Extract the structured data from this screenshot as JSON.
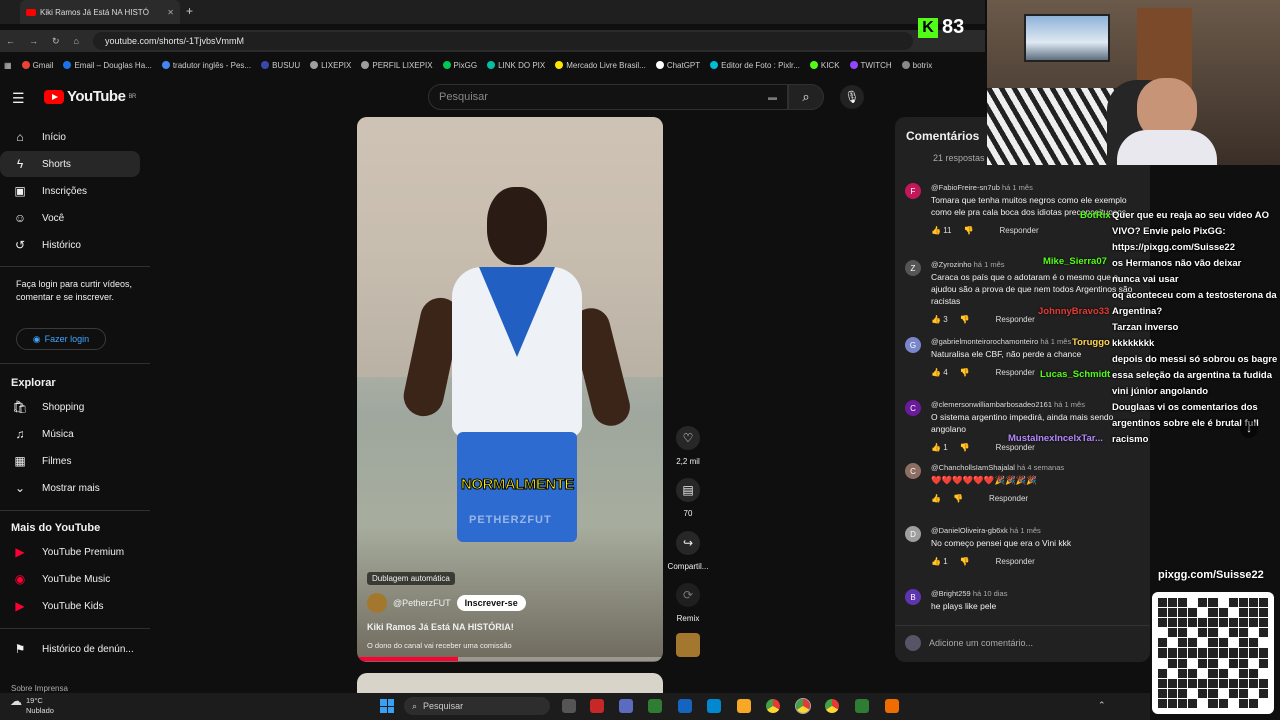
{
  "browser": {
    "tab_title": "Kiki Ramos Já Está NA HISTÓ",
    "url": "youtube.com/shorts/-1TjvbsVmmM",
    "bookmarks": [
      "Gmail",
      "Email – Douglas Ha...",
      "tradutor inglês - Pes...",
      "BUSUU",
      "LIXEPIX",
      "PERFIL LIXEPIX",
      "PixGG",
      "LINK DO PIX",
      "Mercado Livre Brasil...",
      "ChatGPT",
      "Editor de Foto : Pixlr...",
      "KICK",
      "TWITCH",
      "botrix"
    ]
  },
  "youtube": {
    "logo_text": "YouTube",
    "region": "BR",
    "search_placeholder": "Pesquisar",
    "sidebar": {
      "main": [
        {
          "label": "Início",
          "icon": "home-icon"
        },
        {
          "label": "Shorts",
          "icon": "shorts-icon"
        },
        {
          "label": "Inscrições",
          "icon": "subscriptions-icon"
        },
        {
          "label": "Você",
          "icon": "you-icon"
        },
        {
          "label": "Histórico",
          "icon": "history-icon"
        }
      ],
      "login_prompt": "Faça login para curtir vídeos, comentar e se inscrever.",
      "login_button": "Fazer login",
      "explore_title": "Explorar",
      "explore": [
        {
          "label": "Shopping"
        },
        {
          "label": "Música"
        },
        {
          "label": "Filmes"
        },
        {
          "label": "Mostrar mais"
        }
      ],
      "more_title": "Mais do YouTube",
      "more": [
        {
          "label": "YouTube Premium"
        },
        {
          "label": "YouTube Music"
        },
        {
          "label": "YouTube Kids"
        }
      ],
      "report_history": "Histórico de denún...",
      "footer": "Sobre  Imprensa"
    },
    "short": {
      "caption": "NORMALMENTE",
      "watermark": "PETHERZFUT",
      "dub_badge": "Dublagem automática",
      "channel": "@PetherzFUT",
      "subscribe": "Inscrever-se",
      "title": "Kiki Ramos Já Está NA HISTÓRIA!",
      "note": "O dono do canal vai receber uma comissão",
      "progress": 0.33
    },
    "actions": {
      "likes": "2,2 mil",
      "comments": "70",
      "share": "Compartil...",
      "remix": "Remix"
    },
    "comments": {
      "title": "Comentários",
      "count": "21 respostas",
      "items": [
        {
          "initial": "F",
          "color": "#c2185b",
          "author": "@FabioFreire-sn7ub",
          "time": "há 1 mês",
          "text": "Tomara que tenha muitos negros como ele exemplo como ele pra cala boca dos idiotas preconceituosos",
          "likes": "11",
          "reply": "Responder"
        },
        {
          "initial": "Z",
          "color": "#555555",
          "author": "@Zyrozinho",
          "time": "há 1 mês",
          "text": "Caraca os país que o adotaram é o mesmo que o ajudou são a prova de que nem todos Argentinos são racistas",
          "likes": "3",
          "reply": "Responder"
        },
        {
          "initial": "G",
          "color": "#7986cb",
          "author": "@gabrielmonteirorochamonteiro",
          "time": "há 1 mês",
          "text": "Naturalisa ele CBF, não perde a chance",
          "likes": "4",
          "reply": "Responder"
        },
        {
          "initial": "C",
          "color": "#6a1b9a",
          "author": "@clemersonwilliambarbosadeo2161",
          "time": "há 1 mês",
          "text": "O sistema argentino impedirá, ainda mais sendo angolano",
          "likes": "1",
          "reply": "Responder"
        },
        {
          "initial": "C",
          "color": "#8d6e63",
          "author": "@ChanchollsIamShajalal",
          "time": "há 4 semanas",
          "text": "❤️❤️❤️❤️❤️❤️🎉🎉🎉🎉",
          "likes": "",
          "reply": "Responder"
        },
        {
          "initial": "D",
          "color": "#9e9e9e",
          "author": "@DanielOliveira-gb6xk",
          "time": "há 1 mês",
          "text": "No começo pensei que era o Vini kkk",
          "likes": "1",
          "reply": "Responder"
        },
        {
          "initial": "B",
          "color": "#5e35b1",
          "author": "@Bright259",
          "time": "há 10 dias",
          "text": "he plays like pele",
          "likes": "",
          "reply": ""
        }
      ],
      "add_placeholder": "Adicione um comentário..."
    }
  },
  "stream": {
    "kick_viewers": "83",
    "chat": [
      "Quer que eu reaja ao seu vídeo AO VIVO? Envie pelo PixGG: https://pixgg.com/Suisse22",
      "os Hermanos não vão deixar",
      "nunca vai usar",
      "oq aconteceu com a testosterona da Argentina?",
      "Tarzan inverso",
      "kkkkkkkk",
      "depois do messi só sobrou os bagre essa seleção da argentina ta fudida",
      "vini júnior angolando",
      "Douglaas vi os comentarios dos argentinos sobre ele é brutal full racismo"
    ],
    "chat_names": [
      {
        "name": "BotRix",
        "color": "#53fc18"
      },
      {
        "name": "Mike_Sierra07",
        "color": "#53fc18"
      },
      {
        "name": "JohnnyBravo33",
        "color": "#e53935"
      },
      {
        "name": "Toruggo",
        "color": "#ffd54f"
      },
      {
        "name": "Lucas_Schmidt",
        "color": "#53fc18"
      },
      {
        "name": "MustaInexIncelxTar...",
        "color": "#b388ff"
      }
    ],
    "pix_url": "pixgg.com/Suisse22"
  },
  "taskbar": {
    "temp": "19°C",
    "weather": "Nublado",
    "search": "Pesquisar"
  }
}
